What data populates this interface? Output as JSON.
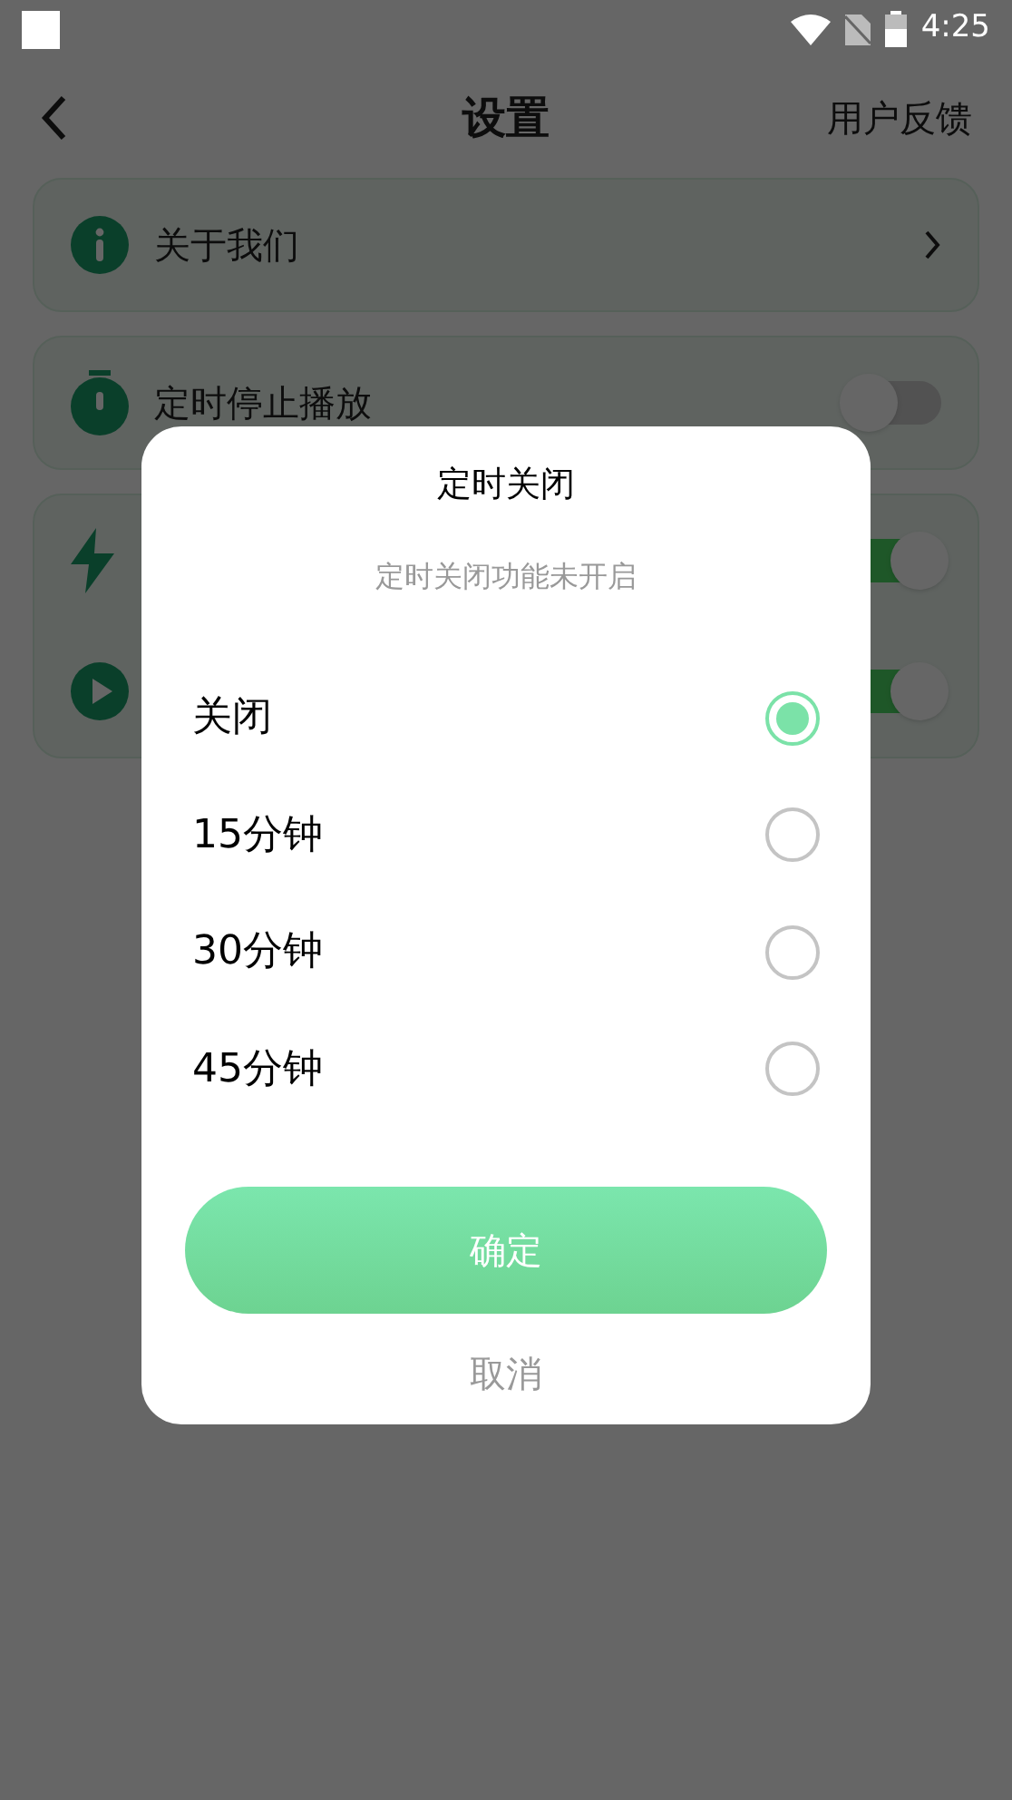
{
  "status_bar": {
    "time": "4:25"
  },
  "header": {
    "title": "设置",
    "action": "用户反馈"
  },
  "settings": [
    {
      "items": [
        {
          "kind": "link",
          "label": "关于我们"
        }
      ]
    },
    {
      "items": [
        {
          "kind": "toggle",
          "label": "定时停止播放",
          "on": false
        }
      ]
    },
    {
      "items": [
        {
          "kind": "toggle",
          "on": true
        },
        {
          "kind": "toggle",
          "on": true
        }
      ]
    }
  ],
  "dialog": {
    "title": "定时关闭",
    "subtitle": "定时关闭功能未开启",
    "options": [
      {
        "label": "关闭",
        "selected": true
      },
      {
        "label": "15分钟",
        "selected": false
      },
      {
        "label": "30分钟",
        "selected": false
      },
      {
        "label": "45分钟",
        "selected": false
      }
    ],
    "confirm": "确定",
    "cancel": "取消"
  }
}
